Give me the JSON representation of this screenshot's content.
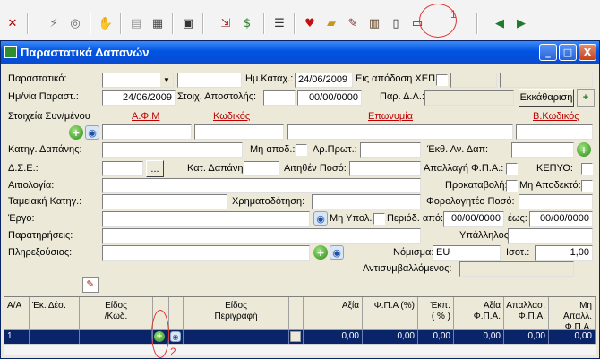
{
  "toolbar": {
    "buttons": [
      "close-x-icon",
      "filter-icon",
      "binoculars-icon",
      "handshake-icon",
      "document-icon",
      "table-icon",
      "calculator-icon",
      "export-icon",
      "money-bag-icon",
      "list-icon",
      "heart-shield-icon",
      "folder-icon",
      "notebook-icon",
      "register-icon",
      "document-edit-icon",
      "window-icon",
      "exit-left-icon",
      "exit-right-icon"
    ],
    "annotation_1": "1"
  },
  "window": {
    "title": "Παραστατικά Δαπανών",
    "min_label": "_",
    "max_label": "□",
    "close_label": "X"
  },
  "form": {
    "parastatiko_label": "Παραστατικό:",
    "hm_katax_label": "Ημ.Καταχ.:",
    "hm_katax_value": "24/06/2009",
    "eis_apodosi_label": "Εις απόδοση ΧΕΠ",
    "hm_parast_label": "Ημ/νία Παραστ.:",
    "hm_parast_value": "24/06/2009",
    "stoix_apostolis_label": "Στοιχ. Αποστολής:",
    "stoix_apostolis_value": "00/00/0000",
    "par_da_label": "Παρ. Δ.Λ.:",
    "ekkatharisi_label": "Εκκάθαριση",
    "stoixeia_label": "Στοιχεία Συν/μένου",
    "afm_label": "Α.Φ.Μ",
    "kodikos_label": "Κωδικός",
    "eponymia_label": "Επωνυμία",
    "b_kodikos_label": "Β.Κωδικός",
    "katig_dapanis_label": "Κατηγ. Δαπάνης:",
    "mi_apod_label": "Μη αποδ.:",
    "ar_prot_label": "Αρ.Πρωτ.:",
    "ekth_an_dap_label": "Έκθ. Αν. Δαπ:",
    "dse_label": "Δ.Σ.Ε.:",
    "dse_btn": "...",
    "kat_dapanis_label": "Κατ. Δαπάνης:",
    "aitithen_label": "Αιτηθέν Ποσό:",
    "apallagi_label": "Απαλλαγή Φ.Π.Α.:",
    "kepyo_label": "ΚΕΠΥΟ:",
    "aitiologia_label": "Αιτιολογία:",
    "prokatavoli_label": "Προκαταβολή:",
    "mi_apodekto_label": "Μη Αποδεκτό:",
    "tameiaki_label": "Ταμειακή Κατηγ.:",
    "xrimatodotisi_label": "Χρηματοδότηση:",
    "forologiteo_label": "Φορολογητέο Ποσό:",
    "ergo_label": "Έργο:",
    "mi_ypol_label": "Μη Υπολ.:",
    "periodos_label": "Περιόδ. από:",
    "periodos_from": "00/00/0000",
    "eos_label": "έως:",
    "periodos_to": "00/00/0000",
    "paratiriseis_label": "Παρατηρήσεις:",
    "ypallilos_label": "Υπάλληλος:",
    "plirexousios_label": "Πληρεξούσιος:",
    "nomisma_label": "Νόμισμα:",
    "nomisma_value": "EU",
    "isot_label": "Ισοτ.:",
    "isot_value": "1,00",
    "antisymv_label": "Αντισυμβαλλόμενος:"
  },
  "grid": {
    "headers": [
      "Α/Α",
      "Έκ. Δέσ.",
      "Είδος\n/Κωδ.",
      "Είδος\nΠεριγραφή",
      "Αξία",
      "Φ.Π.Α (%)",
      "Έκπ.\n( % )",
      "Αξία\nΦ.Π.Α.",
      "Απαλλασ.\nΦ.Π.Α.",
      "Μη Απαλλ.\nΦ.Π.Α."
    ],
    "row": {
      "aa": "1",
      "axia": "0,00",
      "fpa_pct": "0,00",
      "ekp": "0,00",
      "axia_fpa": "0,00",
      "apallas": "0,00",
      "mi_apall": "0,00"
    },
    "annotation_2": "2"
  }
}
